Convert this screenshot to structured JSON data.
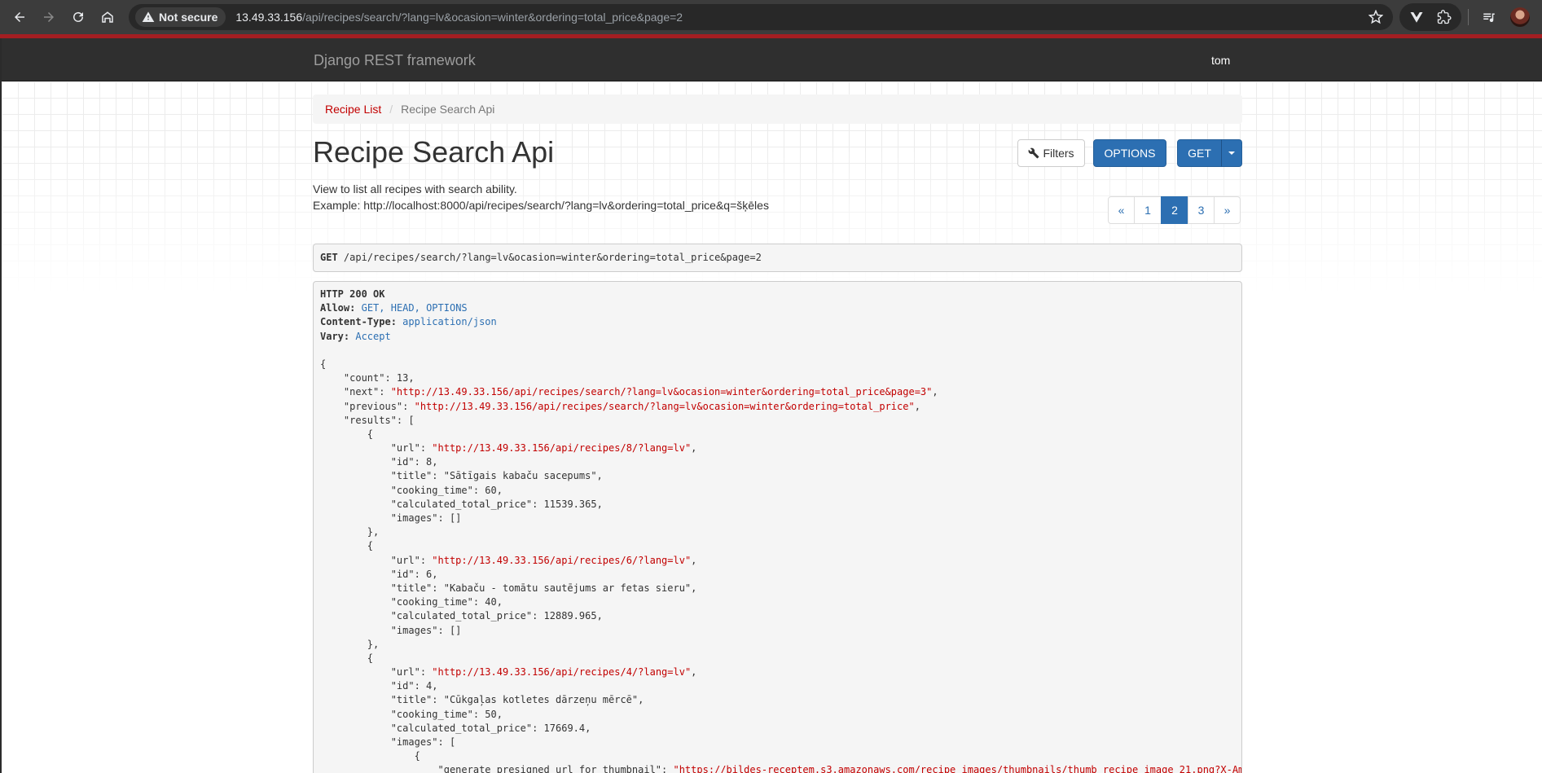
{
  "browser": {
    "security_label": "Not secure",
    "url_host": "13.49.33.156",
    "url_path": "/api/recipes/search/?lang=lv&ocasion=winter&ordering=total_price&page=2"
  },
  "navbar": {
    "brand": "Django REST framework",
    "user": "tom"
  },
  "breadcrumb": {
    "items": [
      {
        "label": "Recipe List"
      },
      {
        "label": "Recipe Search Api"
      }
    ],
    "divider": "/"
  },
  "header": {
    "title": "Recipe Search Api",
    "description_line1": "View to list all recipes with search ability.",
    "description_line2": "Example: http://localhost:8000/api/recipes/search/?lang=lv&ordering=total_price&q=šķēles"
  },
  "buttons": {
    "filters": "Filters",
    "options": "OPTIONS",
    "get": "GET"
  },
  "pagination": {
    "items": [
      "«",
      "1",
      "2",
      "3",
      "»"
    ],
    "active": "2"
  },
  "request": {
    "method": "GET",
    "path": "/api/recipes/search/?lang=lv&ocasion=winter&ordering=total_price&page=2"
  },
  "response": {
    "status": "HTTP 200 OK",
    "headers": [
      {
        "name": "Allow:",
        "value": "GET, HEAD, OPTIONS"
      },
      {
        "name": "Content-Type:",
        "value": "application/json"
      },
      {
        "name": "Vary:",
        "value": "Accept"
      }
    ],
    "body_lines": [
      {
        "indent": "",
        "key": "",
        "value": "{",
        "type": "plain"
      },
      {
        "indent": "    ",
        "key": "\"count\": ",
        "value": "13,",
        "type": "plain"
      },
      {
        "indent": "    ",
        "key": "\"next\": ",
        "value": "\"http://13.49.33.156/api/recipes/search/?lang=lv&ocasion=winter&ordering=total_price&page=3\"",
        "tail": ",",
        "type": "str"
      },
      {
        "indent": "    ",
        "key": "\"previous\": ",
        "value": "\"http://13.49.33.156/api/recipes/search/?lang=lv&ocasion=winter&ordering=total_price\"",
        "tail": ",",
        "type": "str"
      },
      {
        "indent": "    ",
        "key": "\"results\": ",
        "value": "[",
        "type": "plain"
      },
      {
        "indent": "        ",
        "key": "",
        "value": "{",
        "type": "plain"
      },
      {
        "indent": "            ",
        "key": "\"url\": ",
        "value": "\"http://13.49.33.156/api/recipes/8/?lang=lv\"",
        "tail": ",",
        "type": "str"
      },
      {
        "indent": "            ",
        "key": "\"id\": ",
        "value": "8,",
        "type": "plain"
      },
      {
        "indent": "            ",
        "key": "\"title\": ",
        "value": "\"Sātīgais kabaču sacepums\",",
        "type": "plain"
      },
      {
        "indent": "            ",
        "key": "\"cooking_time\": ",
        "value": "60,",
        "type": "plain"
      },
      {
        "indent": "            ",
        "key": "\"calculated_total_price\": ",
        "value": "11539.365,",
        "type": "plain"
      },
      {
        "indent": "            ",
        "key": "\"images\": ",
        "value": "[]",
        "type": "plain"
      },
      {
        "indent": "        ",
        "key": "",
        "value": "},",
        "type": "plain"
      },
      {
        "indent": "        ",
        "key": "",
        "value": "{",
        "type": "plain"
      },
      {
        "indent": "            ",
        "key": "\"url\": ",
        "value": "\"http://13.49.33.156/api/recipes/6/?lang=lv\"",
        "tail": ",",
        "type": "str"
      },
      {
        "indent": "            ",
        "key": "\"id\": ",
        "value": "6,",
        "type": "plain"
      },
      {
        "indent": "            ",
        "key": "\"title\": ",
        "value": "\"Kabaču - tomātu sautējums ar fetas sieru\",",
        "type": "plain"
      },
      {
        "indent": "            ",
        "key": "\"cooking_time\": ",
        "value": "40,",
        "type": "plain"
      },
      {
        "indent": "            ",
        "key": "\"calculated_total_price\": ",
        "value": "12889.965,",
        "type": "plain"
      },
      {
        "indent": "            ",
        "key": "\"images\": ",
        "value": "[]",
        "type": "plain"
      },
      {
        "indent": "        ",
        "key": "",
        "value": "},",
        "type": "plain"
      },
      {
        "indent": "        ",
        "key": "",
        "value": "{",
        "type": "plain"
      },
      {
        "indent": "            ",
        "key": "\"url\": ",
        "value": "\"http://13.49.33.156/api/recipes/4/?lang=lv\"",
        "tail": ",",
        "type": "str"
      },
      {
        "indent": "            ",
        "key": "\"id\": ",
        "value": "4,",
        "type": "plain"
      },
      {
        "indent": "            ",
        "key": "\"title\": ",
        "value": "\"Cūkgaļas kotletes dārzeņu mērcē\",",
        "type": "plain"
      },
      {
        "indent": "            ",
        "key": "\"cooking_time\": ",
        "value": "50,",
        "type": "plain"
      },
      {
        "indent": "            ",
        "key": "\"calculated_total_price\": ",
        "value": "17669.4,",
        "type": "plain"
      },
      {
        "indent": "            ",
        "key": "\"images\": ",
        "value": "[",
        "type": "plain"
      },
      {
        "indent": "                ",
        "key": "",
        "value": "{",
        "type": "plain"
      },
      {
        "indent": "                    ",
        "key": "\"generate_presigned_url_for_thumbnail\": ",
        "value": "\"https://bildes-receptem.s3.amazonaws.com/recipe_images/thumbnails/thumb_recipe_image_21.png?X-Am",
        "type": "str"
      }
    ]
  },
  "colors": {
    "navbar_bg": "#2f2f2f",
    "accent_blue": "#2c6fb2",
    "link_red": "#c20000",
    "chrome_bg": "#3c3c3c"
  }
}
